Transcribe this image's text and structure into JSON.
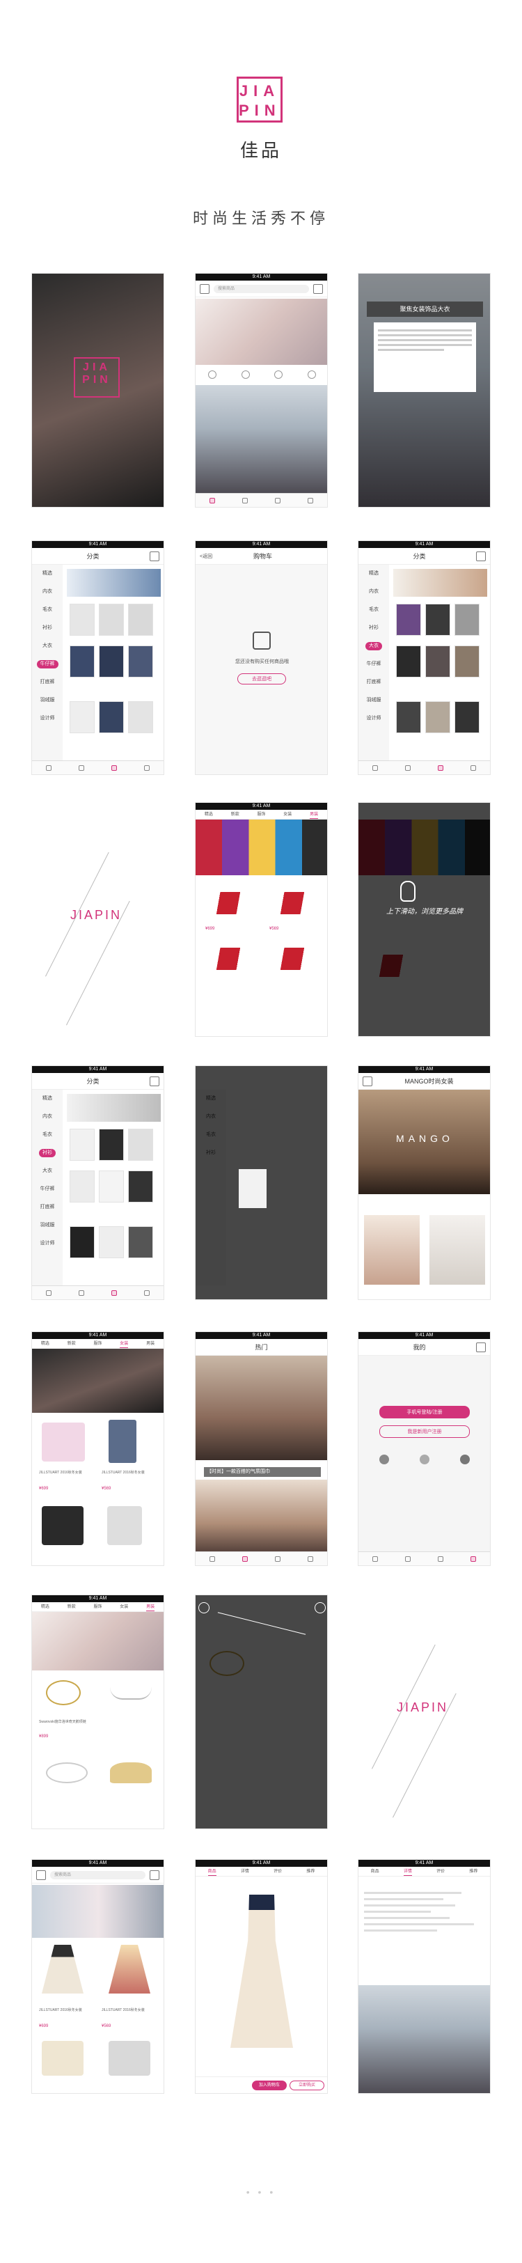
{
  "header": {
    "logo_row1": "JIA",
    "logo_row2": "PIN",
    "brand_cn": "佳品",
    "slogan": "时尚生活秀不停"
  },
  "status_time": "9:41 AM",
  "search_placeholder": "搜索商品",
  "tabs": [
    "精选",
    "新款",
    "服饰",
    "女装",
    "男装"
  ],
  "category": {
    "title": "分类",
    "items": [
      "精选",
      "内衣",
      "毛衣",
      "衬衫",
      "大衣",
      "牛仔裤",
      "打底裤",
      "羽绒服",
      "设计师"
    ],
    "selected_a": "牛仔裤",
    "selected_b": "衬衫"
  },
  "cart": {
    "title": "购物车",
    "back": "<返回",
    "empty_text": "您还没有购买任何商品哦",
    "button": "去逛逛吧"
  },
  "overlay_title": "聚焦女装饰品大衣",
  "jiapin_word": "JIAPIN",
  "gesture_hint": "上下滑动，浏览更多品牌",
  "brand_page_title": "MANGO时尚女装",
  "brand_page_name": "MANGO",
  "hot_title": "热门",
  "hot_caption": "【时尚】一款百搭的气质围巾",
  "profile": {
    "title": "我的",
    "login_button": "手机号登陆/注册",
    "guest_button": "我是新用户注册"
  },
  "product_caption_1": "JILLSTUART 2016秋冬女装",
  "product_caption_2": "JILLSTUART 2016秋冬女装",
  "product_price_1": "¥699",
  "product_price_2": "¥569",
  "jewelry_caption": "Swarovski施华洛世奇天鹅项链",
  "jewelry_price": "¥899",
  "buy_button": "立即购买",
  "cart_button": "加入购物车",
  "detail_tabs": [
    "商品",
    "详情",
    "评价",
    "推荐"
  ],
  "colors": {
    "accent": "#d2337a"
  }
}
